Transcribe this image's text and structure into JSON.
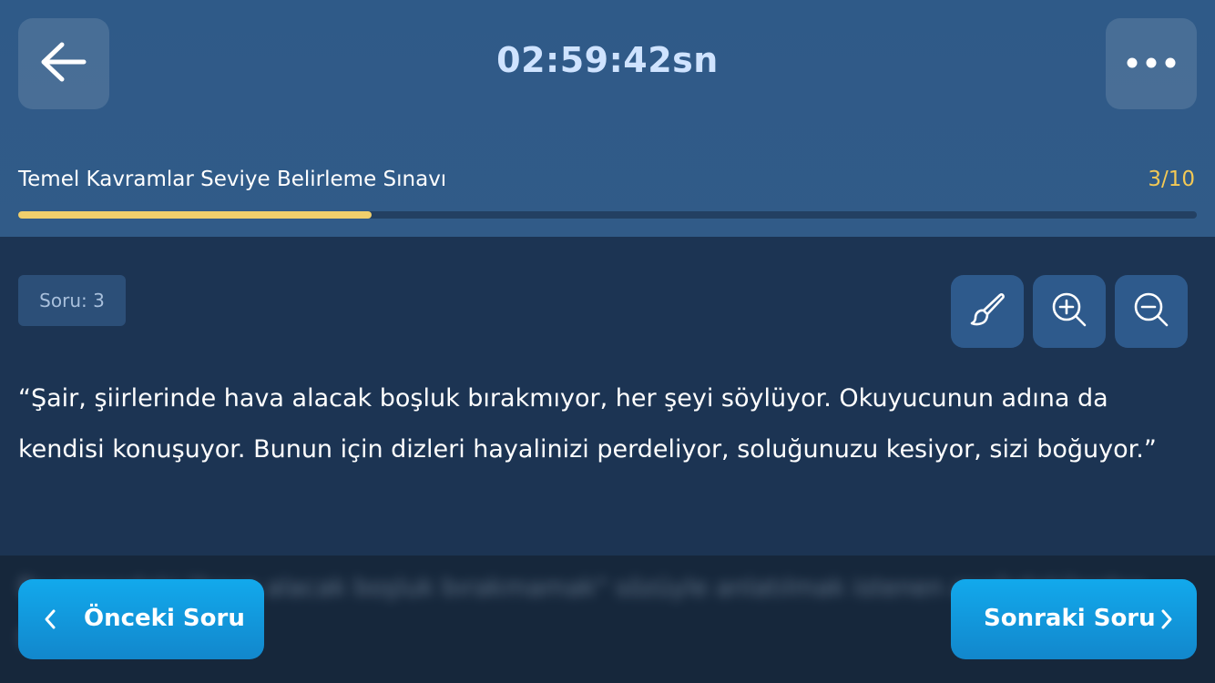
{
  "header": {
    "timer": "02:59:42sn",
    "exam_title": "Temel Kavramlar Seviye Belirleme Sınavı",
    "counter": "3/10",
    "progress": 0.3
  },
  "question": {
    "badge": "Soru: 3",
    "text": "“Şair, şiirlerinde hava alacak boşluk bırakmıyor, her şeyi söylüyor. Okuyucunun adına da kendisi konuşuyor. Bunun için dizleri hayalinizi perdeliyor, soluğunuzu kesiyor, sizi boğuyor.”",
    "blurred_text": "Bu parçadaki \"hava alacak boşluk bırakmamak\" sözüyle anlatılmak istenen aşağıdakilerden hangisidir?"
  },
  "tools": {
    "brush_icon": "paintbrush-icon",
    "zoom_in_icon": "zoom-in-icon",
    "zoom_out_icon": "zoom-out-icon"
  },
  "nav": {
    "prev_label": "Önceki Soru",
    "next_label": "Sonraki Soru"
  },
  "colors": {
    "header_bg": "#2f5a88",
    "content_bg": "#1c3453",
    "accent_yellow": "#f0cf6c",
    "button_blue": "#12a9ec"
  }
}
